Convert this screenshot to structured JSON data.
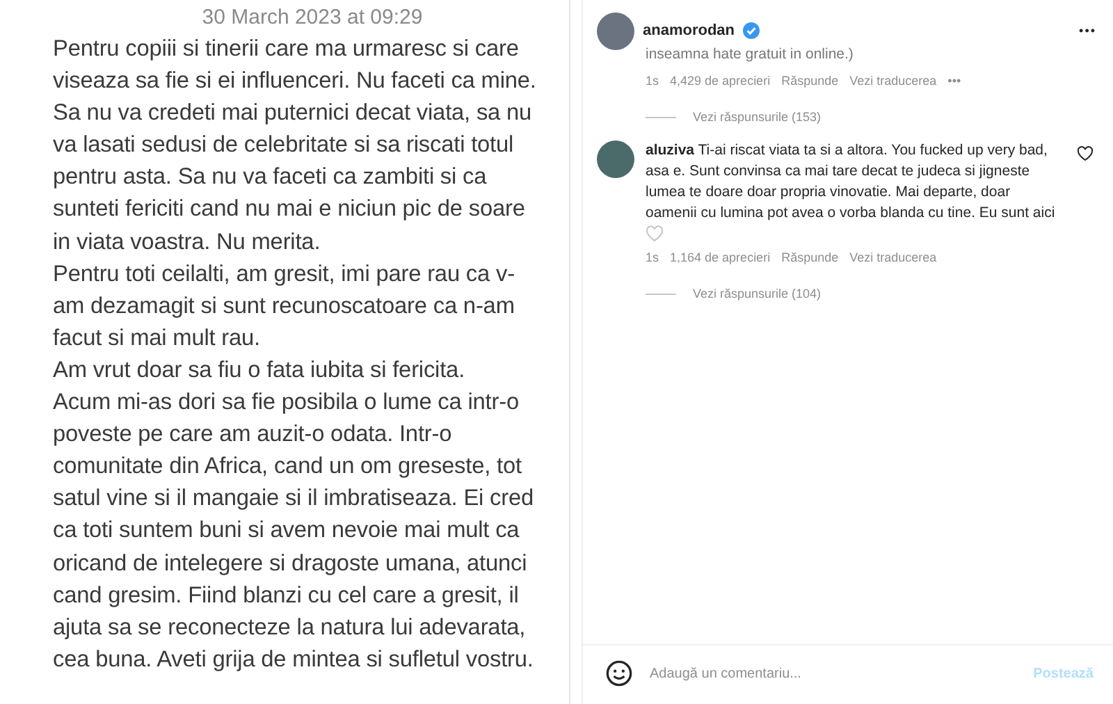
{
  "note": {
    "date": "30 March 2023 at 09:29",
    "lines": [
      "Pentru copiii si tinerii care ma urmaresc si care",
      "viseaza sa fie si ei influenceri. Nu faceti ca mine.",
      "Sa nu va credeti mai puternici decat viata, sa nu",
      "va lasati sedusi de celebritate si sa riscati totul",
      "pentru asta. Sa nu va faceti ca zambiti si ca",
      "sunteti fericiti cand nu mai e niciun pic de soare",
      "in viata voastra. Nu merita.",
      "Pentru toti ceilalti, am gresit, imi pare rau ca v-",
      "am dezamagit si sunt recunoscatoare ca n-am",
      "facut si mai mult rau.",
      "Am vrut doar sa fiu o fata iubita si fericita.",
      "Acum mi-as dori sa fie posibila o lume ca intr-o",
      "poveste pe care am auzit-o odata. Intr-o",
      "comunitate din Africa, cand un om greseste, tot",
      "satul vine si il mangaie si il imbratiseaza. Ei cred",
      "ca toti suntem buni si avem nevoie mai mult ca",
      "oricand de intelegere si dragoste umana, atunci",
      "cand gresim. Fiind blanzi cu cel care a gresit, il",
      "ajuta sa se reconecteze la natura lui adevarata,",
      "cea buna. Aveti grija de mintea si sufletul vostru."
    ]
  },
  "post": {
    "author": "anamorodan",
    "more": "•••"
  },
  "comments": [
    {
      "kind": "continuation",
      "text": "inseamna hate gratuit in online.)",
      "time": "1s",
      "likes": "4,429 de aprecieri",
      "reply": "Răspunde",
      "translate": "Vezi traducerea",
      "more": "•••",
      "replies": "Vezi răspunsurile (153)"
    },
    {
      "kind": "comment",
      "username": "aluziva",
      "text": "Ti-ai riscat viata ta si a altora. You fucked up very bad, asa e. Sunt convinsa ca mai tare decat te judeca si jigneste lumea te doare doar propria vinovatie. Mai departe, doar oamenii cu lumina pot avea o vorba blanda cu tine. Eu sunt aici",
      "time": "1s",
      "likes": "1,164 de aprecieri",
      "reply": "Răspunde",
      "translate": "Vezi traducerea",
      "replies": "Vezi răspunsurile (104)"
    }
  ],
  "comment_box": {
    "placeholder": "Adaugă un comentariu...",
    "post_button": "Postează"
  }
}
